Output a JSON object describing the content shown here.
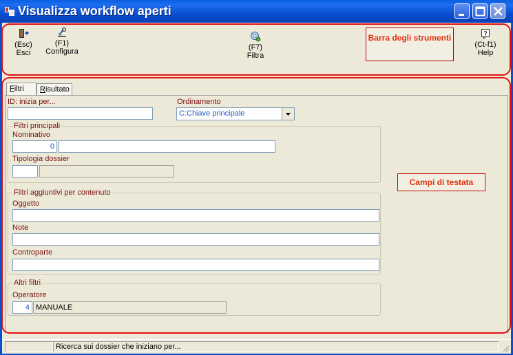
{
  "window": {
    "title": "Visualizza workflow aperti",
    "controls": [
      "minimize-icon",
      "maximize-icon",
      "close-icon"
    ]
  },
  "toolbar": {
    "buttons": [
      {
        "shortcut": "(Esc)",
        "label": "Esci",
        "icon": "exit-door-icon"
      },
      {
        "shortcut": "(F1)",
        "label": "Configura",
        "icon": "configure-icon"
      },
      {
        "shortcut": "(F7)",
        "label": "Filtra",
        "icon": "filter-icon"
      },
      {
        "shortcut": "(Ct-f1)",
        "label": "Help",
        "icon": "help-icon"
      }
    ]
  },
  "annotations": {
    "toolbar_note": "Barra degli strumenti",
    "header_note": "Campi di testata"
  },
  "tabs": [
    {
      "label": "Filtri",
      "mnemonic": "F",
      "active": true
    },
    {
      "label": "Risultato",
      "mnemonic": "R",
      "active": false
    }
  ],
  "filters": {
    "id_label": "ID: inizia per...",
    "id_value": "",
    "ordinamento_label": "Ordinamento",
    "ordinamento_value": "C:Chiave principale",
    "principali": {
      "title": "Filtri principali",
      "nominativo_label": "Nominativo",
      "nominativo_code": "0",
      "nominativo_desc": "",
      "tipologia_label": "Tipologia dossier",
      "tipologia_code": "",
      "tipologia_desc": ""
    },
    "aggiuntivi": {
      "title": "Filtri aggiuntivi per contenuto",
      "oggetto_label": "Oggetto",
      "note_label": "Note",
      "controparte_label": "Controparte"
    },
    "altri": {
      "title": "Altri filtri",
      "operatore_label": "Operatore",
      "operatore_code": "4",
      "operatore_desc": "MANUALE"
    }
  },
  "statusbar": {
    "left": "",
    "message": "Ricerca sui dossier che iniziano per..."
  },
  "colors": {
    "titlebar": "#0A5FE0",
    "annotation_border": "#E01010",
    "label_text": "#7A1010"
  }
}
